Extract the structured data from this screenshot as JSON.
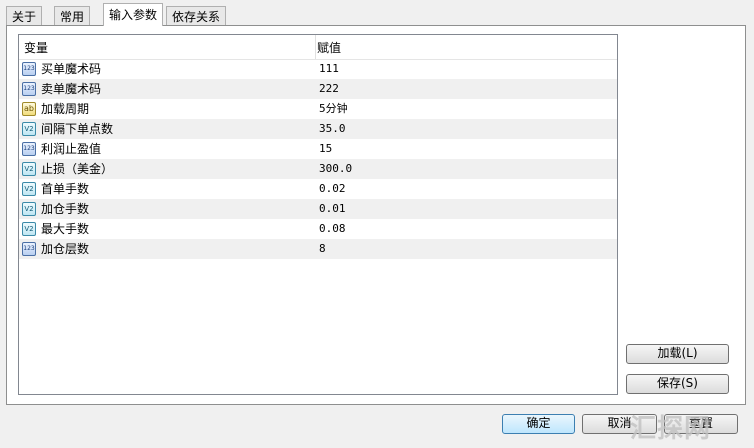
{
  "tabs": [
    "关于",
    "常用",
    "输入参数",
    "依存关系"
  ],
  "active_tab": 2,
  "table": {
    "headers": [
      "变量",
      "赋值"
    ],
    "rows": [
      {
        "type": "int",
        "type_icon": "123",
        "name": "买单魔术码",
        "value": "111"
      },
      {
        "type": "int",
        "type_icon": "123",
        "name": "卖单魔术码",
        "value": "222"
      },
      {
        "type": "enum",
        "type_icon": "ab",
        "name": "加载周期",
        "value": " 5分钟"
      },
      {
        "type": "double",
        "type_icon": "V2",
        "name": "间隔下单点数",
        "value": "35.0"
      },
      {
        "type": "int",
        "type_icon": "123",
        "name": "利润止盈值",
        "value": "15"
      },
      {
        "type": "double",
        "type_icon": "V2",
        "name": "止损（美金）",
        "value": "300.0"
      },
      {
        "type": "double",
        "type_icon": "V2",
        "name": "首单手数",
        "value": "0.02"
      },
      {
        "type": "double",
        "type_icon": "V2",
        "name": "加仓手数",
        "value": "0.01"
      },
      {
        "type": "double",
        "type_icon": "V2",
        "name": "最大手数",
        "value": "0.08"
      },
      {
        "type": "int",
        "type_icon": "123",
        "name": "加仓层数",
        "value": "8"
      }
    ]
  },
  "buttons": {
    "load": "加载(L)",
    "save": "保存(S)",
    "ok": "确定",
    "cancel": "取消",
    "reset": "重置"
  },
  "watermark": "汇探网"
}
